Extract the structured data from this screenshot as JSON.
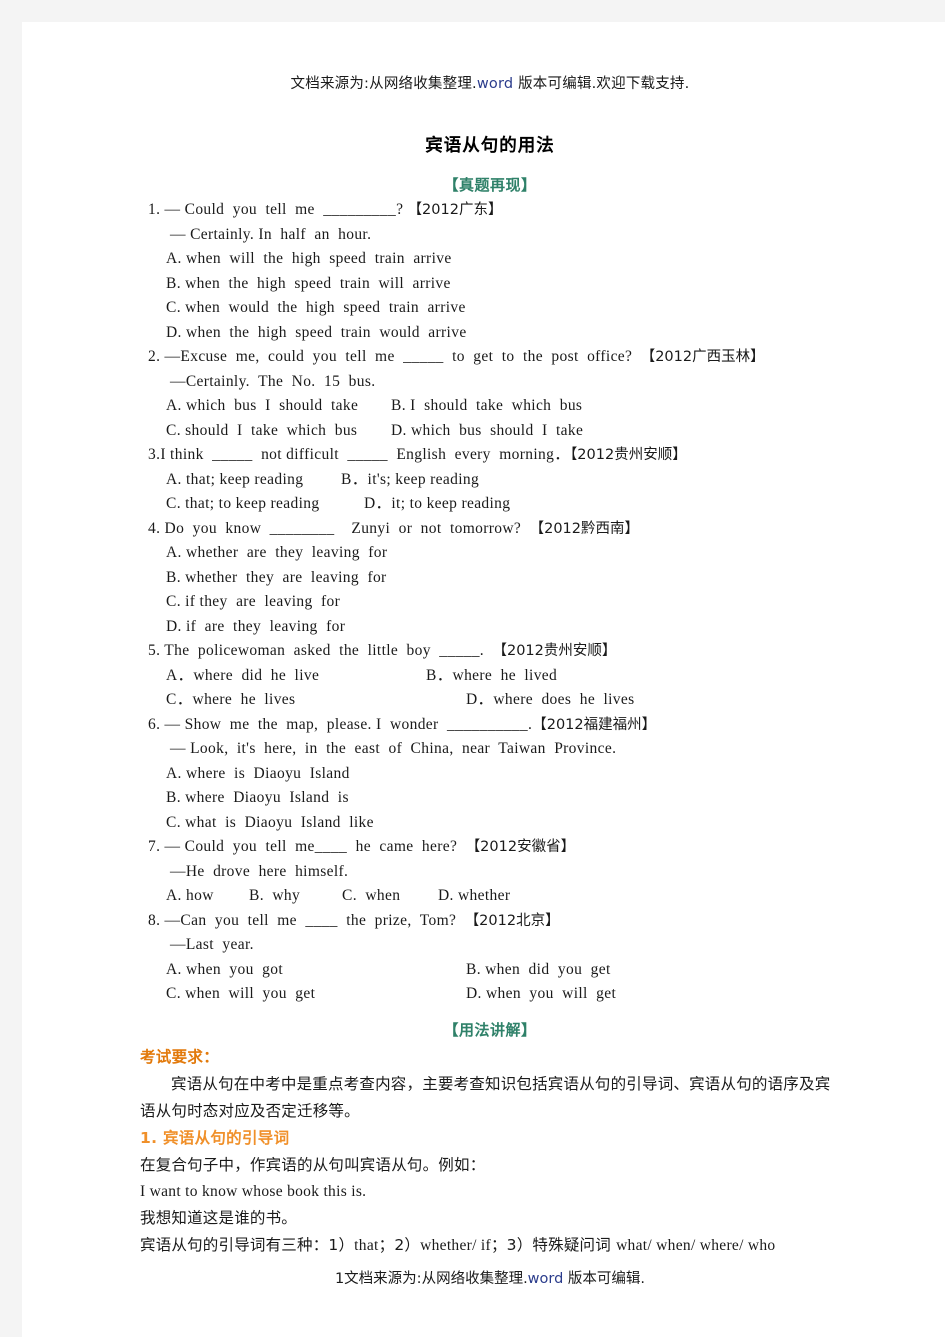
{
  "document": {
    "header_note": "文档来源为:从网络收集整理.word 版本可编辑.欢迎下载支持.",
    "header_note_prefix": "文档来源为:从网络收集整理.",
    "header_note_word": "word",
    "header_note_suffix": " 版本可编辑.欢迎下载支持.",
    "title": "宾语从句的用法",
    "footer_prefix": "1文档来源为:从网络收集整理.",
    "footer_word": "word",
    "footer_suffix": " 版本可编辑."
  },
  "sections": {
    "exam_questions_heading": "【真题再现】",
    "usage_explanation_heading": "【用法讲解】"
  },
  "questions": [
    {
      "stem": "1. — Could  you  tell  me  _________? ",
      "source": "【2012广东】",
      "reply": "— Certainly. In  half  an  hour.",
      "options_single": [
        "A. when  will  the  high  speed  train  arrive",
        "B. when  the  high  speed  train  will  arrive",
        "C. when  would  the  high  speed  train  arrive",
        "D. when  the  high  speed  train  would  arrive"
      ]
    },
    {
      "stem": "2. —Excuse  me,  could  you  tell  me  _____  to  get  to  the  post  office?  ",
      "source": "【2012广西玉林】",
      "reply": "—Certainly.  The  No.  15  bus.",
      "option_pairs": [
        [
          "A. which  bus  I  should  take",
          "B. I  should  take  which  bus"
        ],
        [
          "C. should  I  take  which  bus",
          "D. which  bus  should  I  take"
        ]
      ]
    },
    {
      "stem": "3.I think  _____  not difficult  _____  English  every  morning．",
      "source": "【2012贵州安顺】",
      "option_pairs": [
        [
          "A. that; keep reading",
          "B．it's; keep reading"
        ],
        [
          "C. that; to keep reading",
          "D．it; to keep reading"
        ]
      ]
    },
    {
      "stem": "4. Do  you  know  ________    Zunyi  or  not  tomorrow?  ",
      "source": "【2012黔西南】",
      "options_single": [
        "A. whether  are  they  leaving  for",
        "B. whether  they  are  leaving  for",
        "C. if they  are  leaving  for",
        "D. if  are  they  leaving  for"
      ]
    },
    {
      "stem": "5. The  policewoman  asked  the  little  boy  _____.  ",
      "source": "【2012贵州安顺】",
      "option_pairs": [
        [
          "A．where  did  he  live",
          "B．where  he  lived"
        ],
        [
          "C．where  he  lives",
          "D．where  does  he  lives"
        ]
      ]
    },
    {
      "stem": "6. — Show  me  the  map,  please. I  wonder  __________.",
      "source": "【2012福建福州】",
      "reply": "— Look,  it's  here,  in  the  east  of  China,  near  Taiwan  Province.",
      "options_single": [
        "A. where  is  Diaoyu  Island",
        "B. where  Diaoyu  Island  is",
        "C. what  is  Diaoyu  Island  like"
      ]
    },
    {
      "stem": "7. — Could  you  tell  me____  he  came  here?  ",
      "source": "【2012安徽省】",
      "reply": "—He  drove  here  himself.",
      "options_row": [
        "A. how",
        "B.  why",
        "C.  when",
        "D. whether"
      ]
    },
    {
      "stem": "8. —Can  you  tell  me  ____  the  prize,  Tom?  ",
      "source": "【2012北京】",
      "reply": "—Last  year.",
      "option_pairs": [
        [
          "A. when  you  got",
          "B. when  did  you  get"
        ],
        [
          "C. when  will  you  get",
          "D. when  you  will  get"
        ]
      ]
    }
  ],
  "explanation": {
    "exam_requirement_heading": "考试要求：",
    "exam_requirement_body": "宾语从句在中考中是重点考查内容，主要考查知识包括宾语从句的引导词、宾语从句的语序及宾语从句时态对应及否定迁移等。",
    "point1_heading": "1. 宾语从句的引导词",
    "point1_line1": "在复合句子中，作宾语的从句叫宾语从句。例如：",
    "point1_example_en": "I want  to  know  whose  book  this  is.",
    "point1_example_cn": "我想知道这是谁的书。",
    "point1_line2_cn_a": "宾语从句的引导词有三种：1）",
    "point1_line2_en_a": "that",
    "point1_line2_cn_b": "；2）",
    "point1_line2_en_b": "whether/  if",
    "point1_line2_cn_c": "；3）特殊疑问词 ",
    "point1_line2_en_c": "what/  when/  where/  who"
  },
  "colors": {
    "green_heading": "#2f8169",
    "orange_heading": "#e2790a",
    "orange_subheading": "#f0902a",
    "blue_word": "#2b3c8c",
    "text": "#1a1a1a",
    "page_bg": "#ffffff",
    "canvas_bg": "#f4f4f4"
  }
}
